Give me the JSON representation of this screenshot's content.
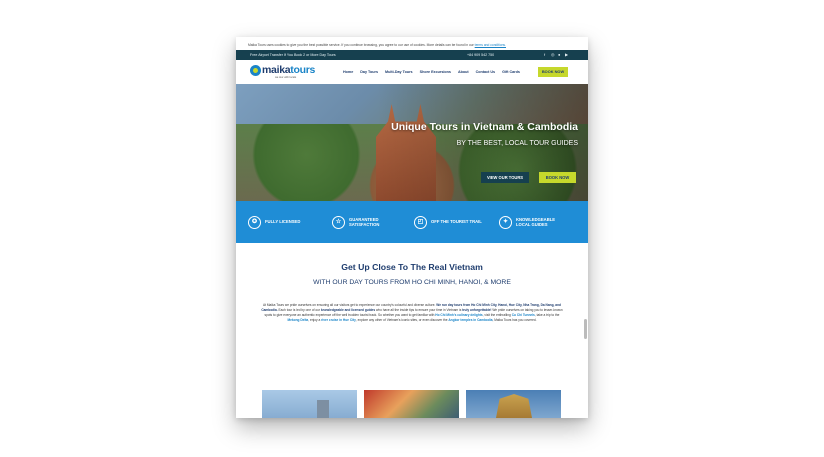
{
  "cookie_bar": {
    "text": "Maika Tours uses cookies to give you the best possible service. If you continue browsing, you agree to our use of cookies. More details can be found in our",
    "link": "terms and conditions."
  },
  "top_bar": {
    "promo": "Free Airport Transfer If You Book 2 or More Day Tours",
    "phone": "+84 909 542 750",
    "social": [
      "facebook-icon",
      "instagram-icon",
      "tripadvisor-icon",
      "youtube-icon"
    ]
  },
  "nav": {
    "logo_text_1": "maika",
    "logo_text_2": "tours",
    "logo_tagline": "we tour with locals",
    "items": [
      "Home",
      "Day Tours",
      "Multi-Day Tours",
      "Shore Excursions",
      "About",
      "Contact Us",
      "Gift Cards"
    ],
    "book_label": "BOOK NOW"
  },
  "hero": {
    "title": "Unique Tours in Vietnam & Cambodia",
    "subtitle": "BY THE BEST, LOCAL TOUR GUIDES",
    "view_label": "VIEW OUR TOURS",
    "book_label": "BOOK NOW"
  },
  "features": [
    {
      "icon": "award-icon",
      "label": "FULLY LICENSED"
    },
    {
      "icon": "star-icon",
      "label": "GUARANTEED SATISFACTION"
    },
    {
      "icon": "map-icon",
      "label": "OFF THE TOURIST TRAIL"
    },
    {
      "icon": "lightbulb-icon",
      "label": "KNOWLEDGEABLE LOCAL GUIDES"
    }
  ],
  "intro": {
    "heading": "Get Up Close To The Real Vietnam",
    "subheading": "WITH OUR DAY TOURS FROM HO CHI MINH, HANOI, & MORE",
    "p1": "At Maika Tours we pride ourselves on ensuring all our visitors get to experience our country's colourful and diverse culture.",
    "p1_bold": "We run day tours from Ho Chi Minh City, Hanoi, Hue City, Nha Trang, Da Nang, and Cambodia.",
    "p2": "Each tour is led by one of our",
    "p2_bold": "knowledgeable and licensed guides",
    "p3": "who have all the inside tips to ensure your time in Vietnam is",
    "p3_bold": "truly unforgettable!",
    "p4": "We pride ourselves on taking you to lesser-known spots to give everyone an authentic experience off the well trodden tourist track. So whether you want to get familiar with",
    "link1": "Ho Chi Minh's culinary delights",
    "p5": ", visit the enthralling",
    "link2": "Cu Chi Tunnels",
    "p6": ", take a trip to the",
    "link3": "Mekong Delta",
    "p7": ", enjoy a",
    "link4": "river cruise in Hue City",
    "p8": ", explore any other of Vietnam's iconic sites, or even discover the",
    "link5": "Angkor temples in Cambodia",
    "p9": ", Maika Tours has you covered."
  }
}
